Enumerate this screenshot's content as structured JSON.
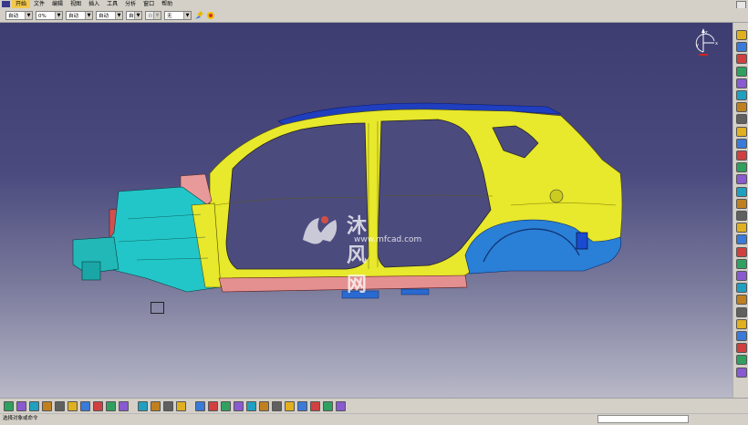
{
  "menubar": {
    "items": [
      "开始",
      "文件",
      "编辑",
      "视图",
      "插入",
      "工具",
      "分析",
      "窗口",
      "帮助"
    ],
    "active_index": 0
  },
  "toolbar": {
    "combos": [
      {
        "value": "自动",
        "disabled": false
      },
      {
        "value": "0%",
        "disabled": false
      },
      {
        "value": "自动",
        "disabled": false
      },
      {
        "value": "自动",
        "disabled": false
      },
      {
        "value": "自动",
        "disabled": false
      },
      {
        "value": "自动",
        "disabled": true
      },
      {
        "value": "无",
        "disabled": false
      }
    ]
  },
  "watermark": {
    "title": "沐风网",
    "url": "www.mfcad.com"
  },
  "compass": {
    "axis_x": "x",
    "axis_y": "y",
    "axis_z": "z"
  },
  "status": {
    "text": "选择对象或命令"
  },
  "colors": {
    "viewport_top": "#3e3d71",
    "body_yellow": "#e8e82c",
    "roof_blue": "#1f3fbf",
    "rear_blue": "#2a7fd6",
    "front_cyan": "#22c6c8",
    "pink": "#e89a9a",
    "active_menu": "#f2c94c"
  },
  "icons": {
    "right_toolbar": [
      "sketch-icon",
      "pad-icon",
      "pocket-icon",
      "shaft-icon",
      "groove-icon",
      "hole-icon",
      "rib-icon",
      "slot-icon",
      "stiffener-icon",
      "loft-icon",
      "fillet-icon",
      "chamfer-icon",
      "draft-icon",
      "shell-icon",
      "thickness-icon",
      "thread-icon",
      "boolean-icon",
      "translate-icon",
      "rotate-icon",
      "mirror-icon",
      "pattern-icon",
      "scale-icon",
      "constraint-icon",
      "axis-icon",
      "plane-icon",
      "point-icon",
      "line-icon",
      "measure-icon",
      "apply-material-icon"
    ],
    "bottom_toolbar": [
      "new-icon",
      "open-icon",
      "save-icon",
      "print-icon",
      "cut-icon",
      "copy-icon",
      "paste-icon",
      "undo-icon",
      "redo-icon",
      "help-icon",
      "formula-icon",
      "comment-icon",
      "catalog-icon",
      "hub-icon",
      "fit-all-icon",
      "pan-icon",
      "rotate-view-icon",
      "zoom-in-icon",
      "zoom-out-icon",
      "normal-view-icon",
      "multi-view-icon",
      "iso-view-icon",
      "shading-icon",
      "hide-show-icon",
      "swap-icon",
      "render-icon"
    ]
  }
}
